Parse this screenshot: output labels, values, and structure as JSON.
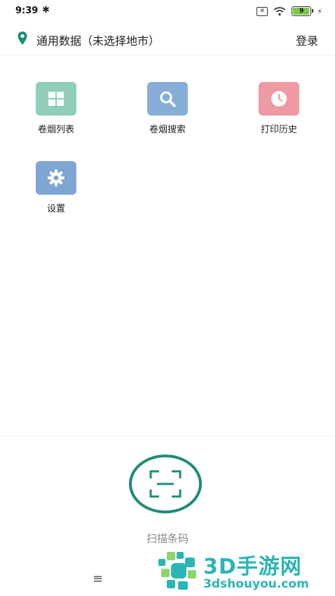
{
  "status_bar": {
    "time": "9:39",
    "battery": "9"
  },
  "header": {
    "location": "通用数据（未选择地市）",
    "login": "登录"
  },
  "menu": [
    {
      "label": "卷烟列表",
      "icon": "grid-icon",
      "color": "#8fcfb8"
    },
    {
      "label": "卷烟搜索",
      "icon": "search-icon",
      "color": "#86aed6"
    },
    {
      "label": "打印历史",
      "icon": "clock-icon",
      "color": "#ee9aa4"
    },
    {
      "label": "设置",
      "icon": "gear-icon",
      "color": "#7ea6d4"
    }
  ],
  "scan": {
    "label": "扫描条码"
  },
  "nav": {
    "menu_symbol": "≡"
  },
  "watermark": {
    "title": "3D手游网",
    "url": "3dshouyou.com"
  },
  "colors": {
    "accent": "#1e8c76",
    "location_icon": "#1e8c76"
  }
}
